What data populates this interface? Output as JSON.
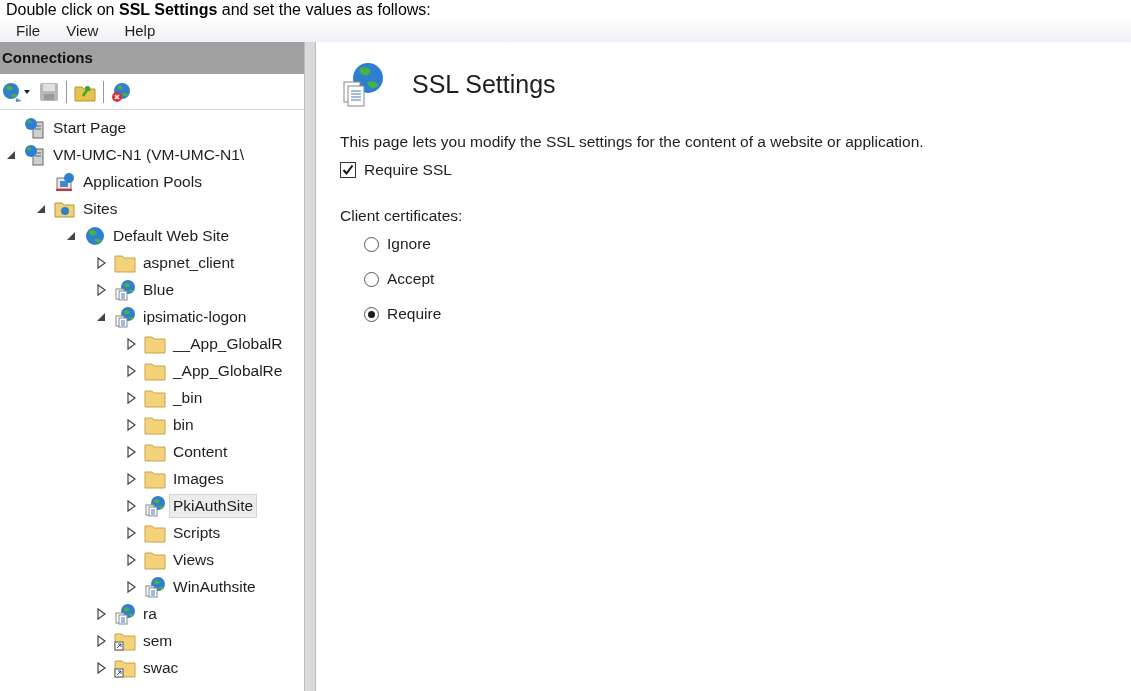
{
  "instruction": "Double click on **SSL Settings** and set the values as follows:",
  "menu": [
    "File",
    "View",
    "Help"
  ],
  "connections": {
    "title": "Connections",
    "tree": [
      {
        "label": "Start Page",
        "kind": "server",
        "selected": false
      },
      {
        "label": "VM-UMC-N1 (VM-UMC-N1\\",
        "kind": "server",
        "expanded": true,
        "selected": false,
        "children": [
          {
            "label": "Application Pools",
            "kind": "pool",
            "selected": false
          },
          {
            "label": "Sites",
            "kind": "sites",
            "expanded": true,
            "selected": false,
            "children": [
              {
                "label": "Default Web Site",
                "kind": "globe",
                "expanded": true,
                "selected": false,
                "children": [
                  {
                    "label": "aspnet_client",
                    "kind": "folder",
                    "expanded": false,
                    "selected": false
                  },
                  {
                    "label": "Blue",
                    "kind": "webapp",
                    "expanded": false,
                    "selected": false
                  },
                  {
                    "label": "ipsimatic-logon",
                    "kind": "webapp",
                    "expanded": true,
                    "selected": false,
                    "children": [
                      {
                        "label": "__App_GlobalR",
                        "kind": "folder",
                        "expanded": false,
                        "selected": false
                      },
                      {
                        "label": "_App_GlobalRe",
                        "kind": "folder",
                        "expanded": false,
                        "selected": false
                      },
                      {
                        "label": "_bin",
                        "kind": "folder",
                        "expanded": false,
                        "selected": false
                      },
                      {
                        "label": "bin",
                        "kind": "folder",
                        "expanded": false,
                        "selected": false
                      },
                      {
                        "label": "Content",
                        "kind": "folder",
                        "expanded": false,
                        "selected": false
                      },
                      {
                        "label": "Images",
                        "kind": "folder",
                        "expanded": false,
                        "selected": false
                      },
                      {
                        "label": "PkiAuthSite",
                        "kind": "webapp",
                        "expanded": false,
                        "selected": true
                      },
                      {
                        "label": "Scripts",
                        "kind": "folder",
                        "expanded": false,
                        "selected": false
                      },
                      {
                        "label": "Views",
                        "kind": "folder",
                        "expanded": false,
                        "selected": false
                      },
                      {
                        "label": "WinAuthsite",
                        "kind": "webapp",
                        "expanded": false,
                        "selected": false
                      }
                    ]
                  },
                  {
                    "label": "ra",
                    "kind": "webapp",
                    "expanded": false,
                    "selected": false
                  },
                  {
                    "label": "sem",
                    "kind": "shortcut",
                    "expanded": false,
                    "selected": false
                  },
                  {
                    "label": "swac",
                    "kind": "shortcut",
                    "expanded": false,
                    "selected": false
                  }
                ]
              }
            ]
          }
        ]
      }
    ]
  },
  "ssl": {
    "title": "SSL Settings",
    "description": "This page lets you modify the SSL settings for the content of a website or application.",
    "require_ssl": {
      "label": "Require SSL",
      "checked": true
    },
    "client_certificates": {
      "label": "Client certificates:",
      "options": [
        {
          "label": "Ignore",
          "selected": false
        },
        {
          "label": "Accept",
          "selected": false
        },
        {
          "label": "Require",
          "selected": true
        }
      ]
    }
  }
}
